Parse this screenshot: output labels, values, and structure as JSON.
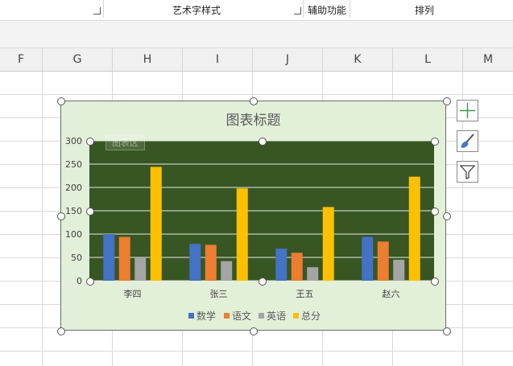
{
  "ribbon": {
    "groups": [
      {
        "label": "艺术字样式"
      },
      {
        "label": "辅助功能"
      },
      {
        "label": "排列"
      }
    ]
  },
  "sheet": {
    "columns": [
      "F",
      "G",
      "H",
      "I",
      "J",
      "K",
      "L",
      "M"
    ]
  },
  "chart": {
    "title": "图表标题",
    "plot_area_label": "图表区"
  },
  "colors": {
    "数学": "#4472c4",
    "语文": "#ed7d31",
    "英语": "#a5a5a5",
    "总分": "#ffc000",
    "plot_bg": "#375623",
    "chart_bg": "#e2efd9"
  },
  "chart_data": {
    "type": "bar",
    "title": "图表标题",
    "categories": [
      "李四",
      "张三",
      "王五",
      "赵六"
    ],
    "series": [
      {
        "name": "数学",
        "values": [
          100,
          79,
          69,
          94
        ]
      },
      {
        "name": "语文",
        "values": [
          94,
          77,
          60,
          84
        ]
      },
      {
        "name": "英语",
        "values": [
          50,
          42,
          29,
          45
        ]
      },
      {
        "name": "总分",
        "values": [
          244,
          198,
          158,
          223
        ]
      }
    ],
    "ylim": [
      0,
      300
    ],
    "yticks": [
      0,
      50,
      100,
      150,
      200,
      250,
      300
    ],
    "grid": true,
    "legend_position": "bottom"
  }
}
